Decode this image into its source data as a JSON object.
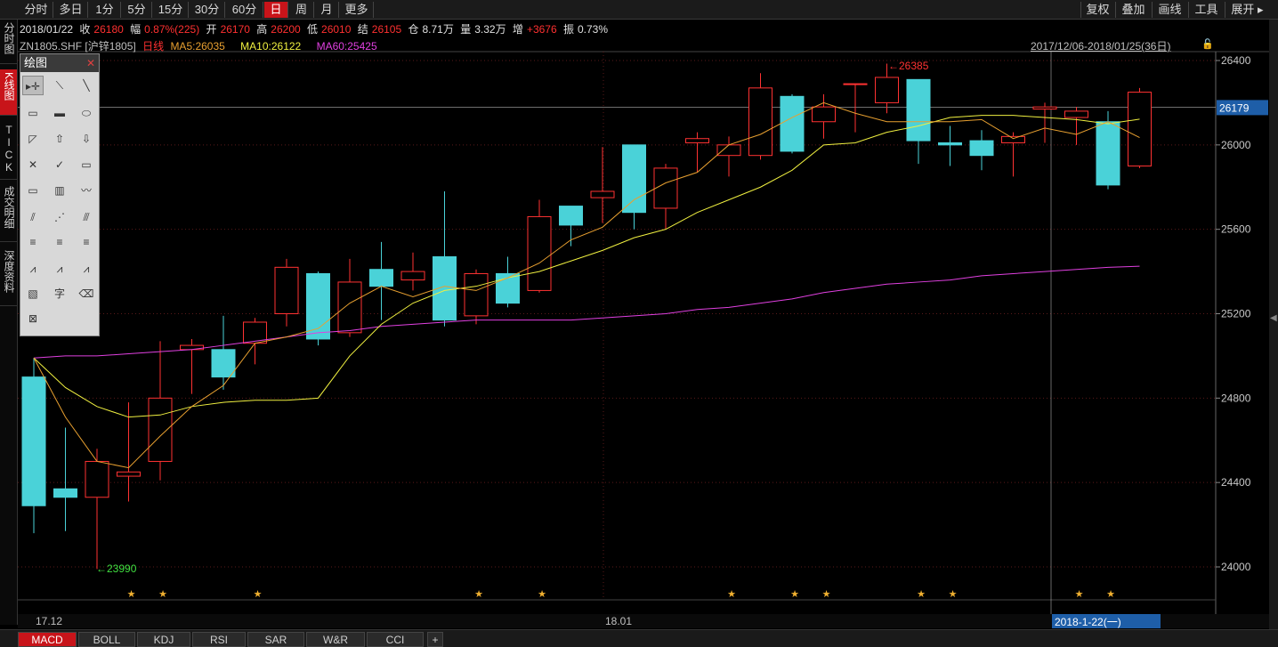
{
  "periods": [
    "分时",
    "多日",
    "1分",
    "5分",
    "15分",
    "30分",
    "60分",
    "日",
    "周",
    "月",
    "更多"
  ],
  "active_period": "日",
  "right_buttons": [
    "复权",
    "叠加",
    "画线",
    "工具",
    "展开"
  ],
  "left_tabs": [
    "分时图",
    "K线图",
    "TICK",
    "成交明细",
    "深度资料"
  ],
  "info": {
    "date": "2018/01/22",
    "close_label": "收",
    "close": "26180",
    "change_label": "幅",
    "change": "0.87%(225)",
    "open_label": "开",
    "open": "26170",
    "high_label": "高",
    "high": "26200",
    "low_label": "低",
    "low": "26010",
    "settle_label": "结",
    "settle": "26105",
    "oi_label": "仓",
    "oi": "8.71万",
    "vol_label": "量",
    "vol": "3.32万",
    "incr_label": "增",
    "incr": "+3676",
    "amp_label": "振",
    "amp": "0.73%"
  },
  "indicator": {
    "symbol": "ZN1805.SHF [沪锌1805]",
    "period": "日线",
    "ma5": "MA5:26035",
    "ma10": "MA10:26122",
    "ma60": "MA60:25425"
  },
  "range": "2017/12/06-2018/01/25(36日)",
  "drawbox": {
    "title": "绘图",
    "tools": [
      {
        "name": "select-tool-icon",
        "g": "▸✛"
      },
      {
        "name": "line-segment-icon",
        "g": "⟍"
      },
      {
        "name": "line-icon",
        "g": "╲"
      },
      {
        "name": "rect-outline-icon",
        "g": "▭"
      },
      {
        "name": "rect-filled-icon",
        "g": "▬"
      },
      {
        "name": "ellipse-icon",
        "g": "⬭"
      },
      {
        "name": "triangle-icon",
        "g": "◸"
      },
      {
        "name": "arrow-up-icon",
        "g": "⇧"
      },
      {
        "name": "arrow-down-icon",
        "g": "⇩"
      },
      {
        "name": "cross-mark-icon",
        "g": "✕"
      },
      {
        "name": "check-mark-icon",
        "g": "✓"
      },
      {
        "name": "price-tag-icon",
        "g": "▭"
      },
      {
        "name": "ruler-icon",
        "g": "▭"
      },
      {
        "name": "bars-icon",
        "g": "▥"
      },
      {
        "name": "wave-icon",
        "g": "〰"
      },
      {
        "name": "channel-icon",
        "g": "⫽"
      },
      {
        "name": "fan-icon",
        "g": "⋰"
      },
      {
        "name": "parallel-icon",
        "g": "⫻"
      },
      {
        "name": "fib-left-icon",
        "g": "≡"
      },
      {
        "name": "fib-mid-icon",
        "g": "≡"
      },
      {
        "name": "fib-right-icon",
        "g": "≡"
      },
      {
        "name": "gann-1-icon",
        "g": "⩘"
      },
      {
        "name": "gann-2-icon",
        "g": "⩘"
      },
      {
        "name": "gann-3-icon",
        "g": "⩘"
      },
      {
        "name": "hatch-icon",
        "g": "▧"
      },
      {
        "name": "text-tool-icon",
        "g": "字"
      },
      {
        "name": "eraser-icon",
        "g": "⌫"
      },
      {
        "name": "delete-all-icon",
        "g": "⊠"
      }
    ]
  },
  "price_axis": {
    "ticks": [
      "26400",
      "26000",
      "25600",
      "25200",
      "24800",
      "24400",
      "24000"
    ],
    "crosshair_value": "26179"
  },
  "x_labels": [
    "17.12",
    "18.01"
  ],
  "crosshair_date": "2018-1-22(一)",
  "annotations": {
    "high": "26385",
    "low": "23990"
  },
  "indicator_tabs": [
    "MACD",
    "BOLL",
    "KDJ",
    "RSI",
    "SAR",
    "W&R",
    "CCI",
    "+"
  ],
  "active_indicator": "MACD",
  "chart_data": {
    "type": "candlestick",
    "ylim": [
      23860,
      26500
    ],
    "candles": [
      {
        "o": 24900,
        "h": 24990,
        "l": 24160,
        "c": 24290
      },
      {
        "o": 24370,
        "h": 24660,
        "l": 24170,
        "c": 24330
      },
      {
        "o": 24330,
        "h": 24560,
        "l": 23990,
        "c": 24500
      },
      {
        "o": 24430,
        "h": 24780,
        "l": 24310,
        "c": 24450
      },
      {
        "o": 24500,
        "h": 25070,
        "l": 24410,
        "c": 24800
      },
      {
        "o": 25030,
        "h": 25080,
        "l": 24820,
        "c": 25050
      },
      {
        "o": 25030,
        "h": 25190,
        "l": 24840,
        "c": 24900
      },
      {
        "o": 25060,
        "h": 25180,
        "l": 24960,
        "c": 25160
      },
      {
        "o": 25200,
        "h": 25460,
        "l": 25140,
        "c": 25420
      },
      {
        "o": 25390,
        "h": 25400,
        "l": 25050,
        "c": 25080
      },
      {
        "o": 25110,
        "h": 25460,
        "l": 25090,
        "c": 25350
      },
      {
        "o": 25410,
        "h": 25540,
        "l": 25170,
        "c": 25330
      },
      {
        "o": 25360,
        "h": 25490,
        "l": 25310,
        "c": 25400
      },
      {
        "o": 25470,
        "h": 25780,
        "l": 25140,
        "c": 25170
      },
      {
        "o": 25190,
        "h": 25410,
        "l": 25150,
        "c": 25390
      },
      {
        "o": 25390,
        "h": 25470,
        "l": 25230,
        "c": 25250
      },
      {
        "o": 25310,
        "h": 25740,
        "l": 25300,
        "c": 25660
      },
      {
        "o": 25710,
        "h": 25710,
        "l": 25520,
        "c": 25620
      },
      {
        "o": 25750,
        "h": 25990,
        "l": 25630,
        "c": 25780
      },
      {
        "o": 26000,
        "h": 26000,
        "l": 25600,
        "c": 25680
      },
      {
        "o": 25700,
        "h": 25910,
        "l": 25600,
        "c": 25890
      },
      {
        "o": 26010,
        "h": 26060,
        "l": 25870,
        "c": 26030
      },
      {
        "o": 25950,
        "h": 26040,
        "l": 25850,
        "c": 26000
      },
      {
        "o": 25950,
        "h": 26340,
        "l": 25930,
        "c": 26270
      },
      {
        "o": 26230,
        "h": 26240,
        "l": 25960,
        "c": 25970
      },
      {
        "o": 26110,
        "h": 26240,
        "l": 26030,
        "c": 26180
      },
      {
        "o": 26290,
        "h": 26290,
        "l": 26060,
        "c": 26290
      },
      {
        "o": 26200,
        "h": 26385,
        "l": 26150,
        "c": 26320
      },
      {
        "o": 26310,
        "h": 26310,
        "l": 25910,
        "c": 26020
      },
      {
        "o": 26010,
        "h": 26090,
        "l": 25900,
        "c": 26000
      },
      {
        "o": 26020,
        "h": 26070,
        "l": 25880,
        "c": 25950
      },
      {
        "o": 26010,
        "h": 26060,
        "l": 25850,
        "c": 26040
      },
      {
        "o": 26170,
        "h": 26200,
        "l": 26010,
        "c": 26180
      },
      {
        "o": 26130,
        "h": 26180,
        "l": 26000,
        "c": 26160
      },
      {
        "o": 26110,
        "h": 26160,
        "l": 25790,
        "c": 25810
      },
      {
        "o": 25900,
        "h": 26270,
        "l": 25890,
        "c": 26250
      }
    ],
    "ma5": [
      24990,
      24710,
      24500,
      24470,
      24620,
      24760,
      24860,
      25060,
      25090,
      25130,
      25250,
      25330,
      25280,
      25330,
      25310,
      25370,
      25440,
      25550,
      25610,
      25740,
      25820,
      25870,
      26000,
      26050,
      26130,
      26200,
      26150,
      26110,
      26110,
      26110,
      26120,
      26030,
      26080,
      26050,
      26110,
      26035
    ],
    "ma10": [
      24990,
      24850,
      24760,
      24710,
      24720,
      24760,
      24780,
      24790,
      24790,
      24800,
      25000,
      25150,
      25250,
      25310,
      25330,
      25370,
      25400,
      25450,
      25500,
      25560,
      25600,
      25680,
      25740,
      25800,
      25880,
      26000,
      26010,
      26060,
      26090,
      26130,
      26140,
      26140,
      26130,
      26120,
      26100,
      26122
    ],
    "ma60": [
      24990,
      25000,
      25000,
      25010,
      25020,
      25030,
      25050,
      25070,
      25090,
      25110,
      25120,
      25140,
      25150,
      25160,
      25170,
      25170,
      25170,
      25170,
      25180,
      25190,
      25200,
      25220,
      25230,
      25250,
      25270,
      25300,
      25320,
      25340,
      25350,
      25360,
      25380,
      25390,
      25400,
      25410,
      25420,
      25425
    ],
    "star_candles": [
      3,
      4,
      7,
      14,
      16,
      22,
      24,
      25,
      28,
      29,
      33,
      34
    ]
  }
}
